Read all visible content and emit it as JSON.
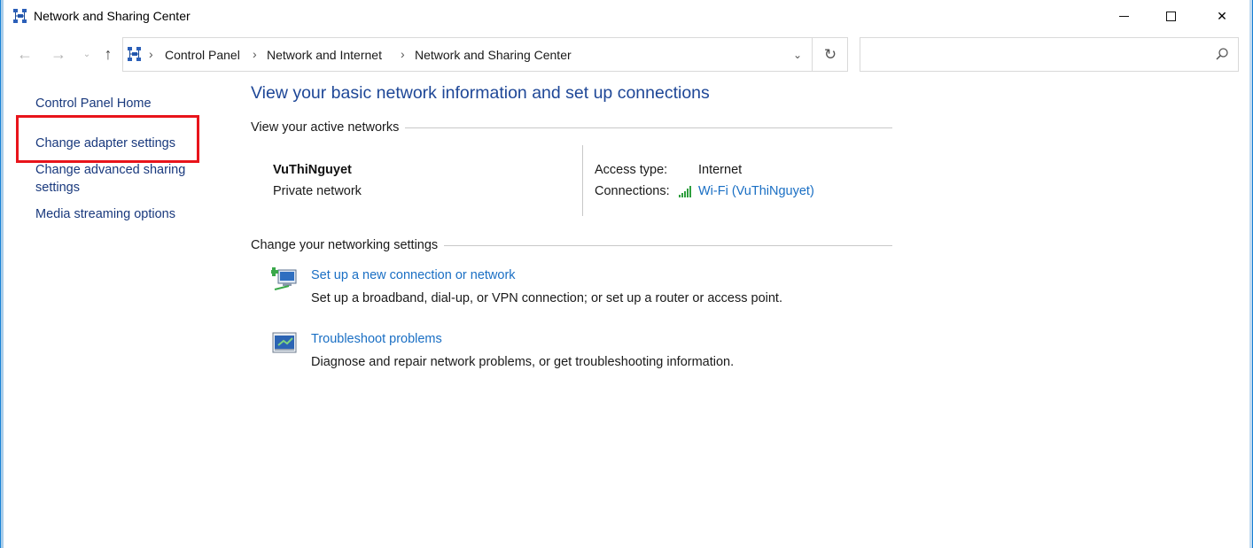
{
  "window": {
    "title": "Network and Sharing Center",
    "icon": "network-sharing-icon",
    "controls": {
      "minimize": "minimize-icon",
      "maximize": "maximize-icon",
      "close": "✕"
    }
  },
  "navigation": {
    "back": "←",
    "forward": "→",
    "recent": "⌄",
    "up": "↑"
  },
  "address_bar": {
    "breadcrumbs": [
      "Control Panel",
      "Network and Internet",
      "Network and Sharing Center"
    ],
    "separator": "›",
    "dropdown": "⌄",
    "refresh": "↻"
  },
  "search": {
    "placeholder": ""
  },
  "sidebar": {
    "items": [
      {
        "label": "Control Panel Home"
      },
      {
        "label": "Change adapter settings",
        "highlighted": true
      },
      {
        "label": "Change advanced sharing settings"
      },
      {
        "label": "Media streaming options"
      }
    ],
    "highlight_color": "#e8141b"
  },
  "main": {
    "title": "View your basic network information and set up connections",
    "active_networks_heading": "View your active networks",
    "network": {
      "name": "VuThiNguyet",
      "type": "Private network",
      "access_type_label": "Access type:",
      "access_type_value": "Internet",
      "connections_label": "Connections:",
      "connection_link": "Wi-Fi (VuThiNguyet)"
    },
    "settings_heading": "Change your networking settings",
    "tasks": [
      {
        "icon": "new-connection-icon",
        "link": "Set up a new connection or network",
        "description": "Set up a broadband, dial-up, or VPN connection; or set up a router or access point."
      },
      {
        "icon": "troubleshoot-icon",
        "link": "Troubleshoot problems",
        "description": "Diagnose and repair network problems, or get troubleshooting information."
      }
    ]
  },
  "colors": {
    "title_blue": "#1e4797",
    "link_blue": "#1a6fc4",
    "nav_link": "#19397d"
  }
}
